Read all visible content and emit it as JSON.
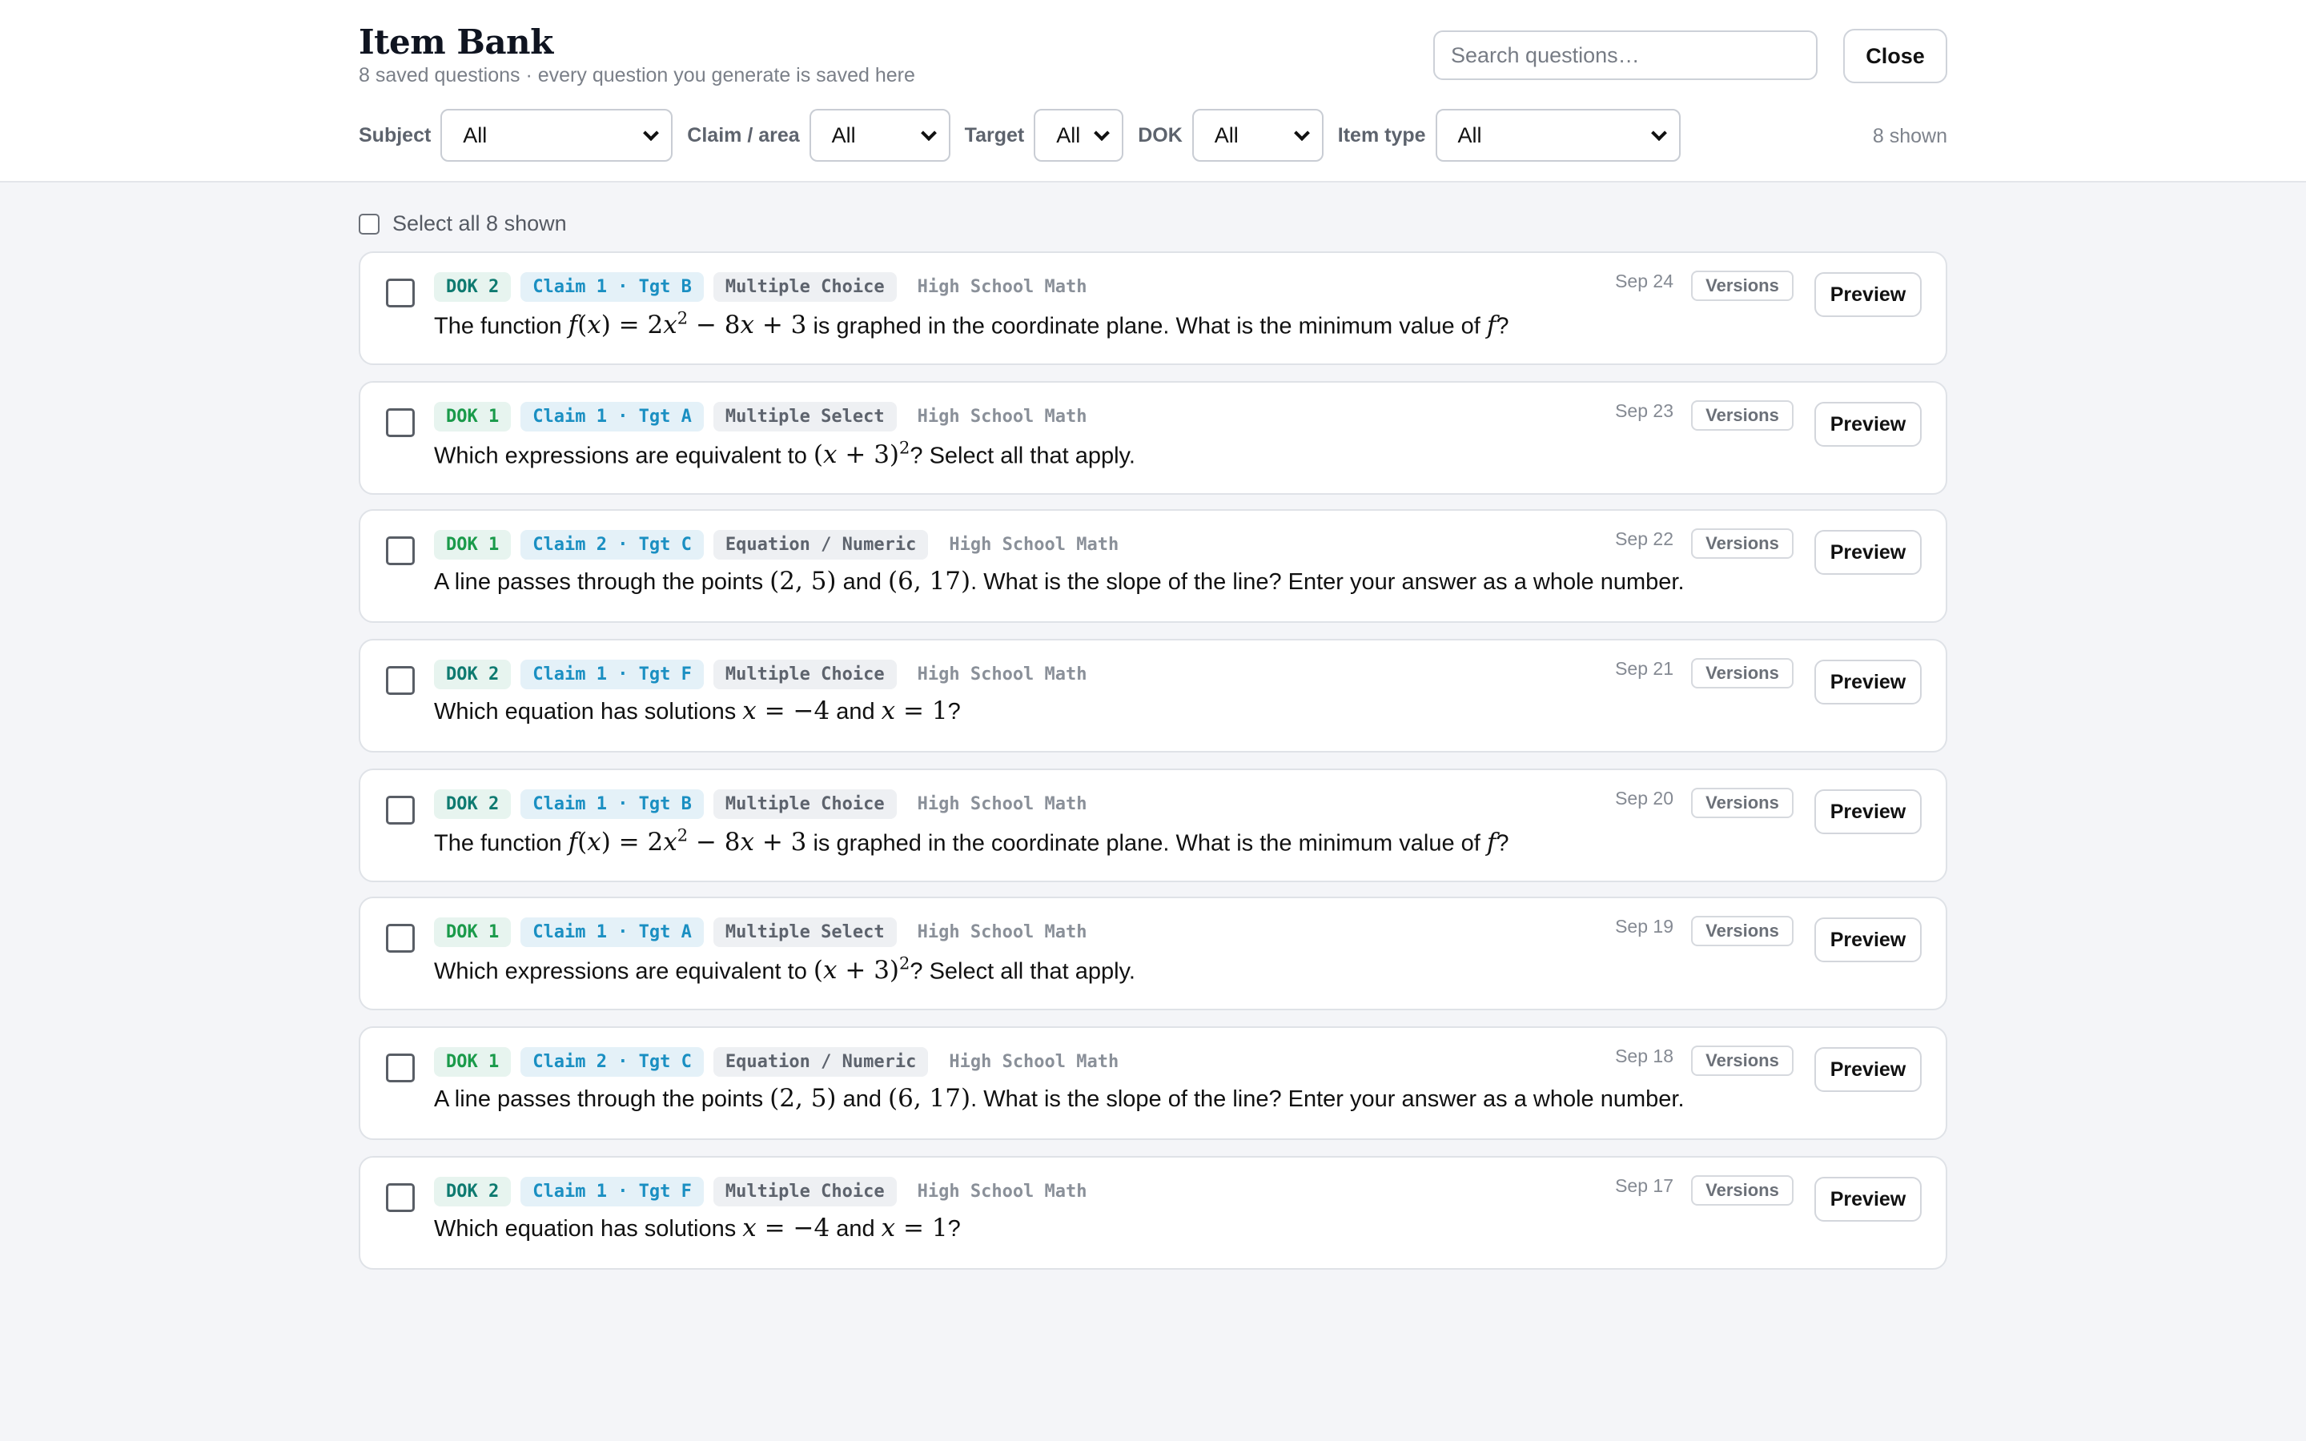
{
  "header": {
    "title": "Item Bank",
    "subtitle": "8 saved questions · every question you generate is saved here",
    "search_placeholder": "Search questions…",
    "close_label": "Close"
  },
  "filters": {
    "subject": {
      "label": "Subject",
      "value": "All"
    },
    "claim": {
      "label": "Claim / area",
      "value": "All"
    },
    "target": {
      "label": "Target",
      "value": "All"
    },
    "dok": {
      "label": "DOK",
      "value": "All"
    },
    "item_type": {
      "label": "Item type",
      "value": "All"
    },
    "shown_count": "8 shown"
  },
  "select_all_label": "Select all 8 shown",
  "buttons": {
    "versions": "Versions",
    "preview": "Preview"
  },
  "colors": {
    "dok1": "#1a9a4a",
    "dok2": "#0e7a70",
    "claim": "#1a8fc2"
  },
  "items": [
    {
      "dok": "DOK 2",
      "claim": "Claim 1 · Tgt B",
      "type": "Multiple Choice",
      "subject": "High School Math",
      "date": "Sep 24",
      "q": "min"
    },
    {
      "dok": "DOK 1",
      "claim": "Claim 1 · Tgt A",
      "type": "Multiple Select",
      "subject": "High School Math",
      "date": "Sep 23",
      "q": "equiv"
    },
    {
      "dok": "DOK 1",
      "claim": "Claim 2 · Tgt C",
      "type": "Equation / Numeric",
      "subject": "High School Math",
      "date": "Sep 22",
      "q": "slope"
    },
    {
      "dok": "DOK 2",
      "claim": "Claim 1 · Tgt F",
      "type": "Multiple Choice",
      "subject": "High School Math",
      "date": "Sep 21",
      "q": "solutions"
    },
    {
      "dok": "DOK 2",
      "claim": "Claim 1 · Tgt B",
      "type": "Multiple Choice",
      "subject": "High School Math",
      "date": "Sep 20",
      "q": "min"
    },
    {
      "dok": "DOK 1",
      "claim": "Claim 1 · Tgt A",
      "type": "Multiple Select",
      "subject": "High School Math",
      "date": "Sep 19",
      "q": "equiv"
    },
    {
      "dok": "DOK 1",
      "claim": "Claim 2 · Tgt C",
      "type": "Equation / Numeric",
      "subject": "High School Math",
      "date": "Sep 18",
      "q": "slope"
    },
    {
      "dok": "DOK 2",
      "claim": "Claim 1 · Tgt F",
      "type": "Multiple Choice",
      "subject": "High School Math",
      "date": "Sep 17",
      "q": "solutions"
    }
  ],
  "questions": {
    "min": [
      "The function ",
      "f(x) = 2x² − 8x + 3",
      " is graphed in the coordinate plane. What is the minimum value of ",
      "f",
      "?"
    ],
    "equiv": [
      "Which expressions are equivalent to ",
      "(x + 3)²",
      "? Select all that apply."
    ],
    "slope": [
      "A line passes through the points ",
      "(2, 5)",
      " and ",
      "(6, 17)",
      ". What is the slope of the line? Enter your answer as a whole number."
    ],
    "solutions": [
      "Which equation has solutions ",
      "x = −4",
      " and ",
      "x = 1",
      "?"
    ]
  }
}
